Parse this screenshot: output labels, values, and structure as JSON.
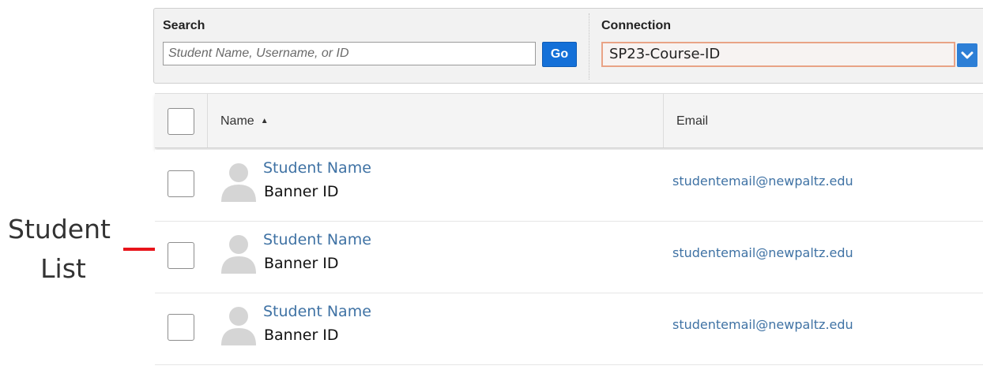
{
  "annotation": {
    "line1": "Student",
    "line2": "List",
    "color": "#e8141b"
  },
  "search": {
    "label": "Search",
    "placeholder": "Student Name, Username, or ID",
    "value": "",
    "go_label": "Go"
  },
  "connection": {
    "label": "Connection",
    "selected": "SP23-Course-ID"
  },
  "table": {
    "columns": {
      "name": "Name",
      "email": "Email"
    },
    "rows": [
      {
        "name": "Student Name",
        "id": "Banner ID",
        "email": "studentemail@newpaltz.edu"
      },
      {
        "name": "Student Name",
        "id": "Banner ID",
        "email": "studentemail@newpaltz.edu"
      },
      {
        "name": "Student Name",
        "id": "Banner ID",
        "email": "studentemail@newpaltz.edu"
      }
    ]
  },
  "icons": {
    "sort": "sort-ascending-icon",
    "avatar": "user-avatar-icon",
    "dropdown": "chevron-down-icon"
  },
  "colors": {
    "accent": "#1470d8",
    "link": "#3f72a4",
    "select_border": "#e9a386"
  }
}
